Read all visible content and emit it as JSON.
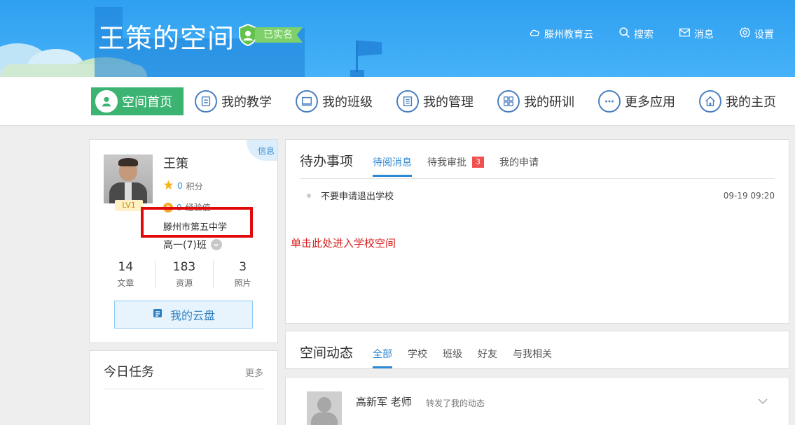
{
  "header": {
    "site_title": "王策的空间",
    "verify_label": "已实名",
    "links": [
      {
        "label": "滕州教育云",
        "icon": "cloud-icon"
      },
      {
        "label": "搜索",
        "icon": "search-icon"
      },
      {
        "label": "消息",
        "icon": "mail-icon"
      },
      {
        "label": "设置",
        "icon": "gear-icon"
      }
    ]
  },
  "mainnav": {
    "items": [
      {
        "label": "空间首页",
        "icon": "user-icon",
        "active": true
      },
      {
        "label": "我的教学",
        "icon": "document-icon"
      },
      {
        "label": "我的班级",
        "icon": "monitor-icon"
      },
      {
        "label": "我的管理",
        "icon": "list-icon"
      },
      {
        "label": "我的研训",
        "icon": "grid-icon"
      },
      {
        "label": "更多应用",
        "icon": "more-icon"
      },
      {
        "label": "我的主页",
        "icon": "home-icon"
      }
    ]
  },
  "profile": {
    "name": "王策",
    "level": "LV1",
    "info_label": "信息",
    "points_value": "0",
    "points_label": "积分",
    "exp_value": "0",
    "exp_label": "经验值",
    "school": "滕州市第五中学",
    "class_name": "高一(7)班",
    "stats": [
      {
        "value": "14",
        "label": "文章"
      },
      {
        "value": "183",
        "label": "资源"
      },
      {
        "value": "3",
        "label": "照片"
      }
    ],
    "cloud_button": "我的云盘"
  },
  "tasks": {
    "title": "今日任务",
    "more": "更多"
  },
  "todo": {
    "title": "待办事项",
    "tabs": [
      {
        "label": "待阅消息",
        "active": true
      },
      {
        "label": "待我审批",
        "badge": "3"
      },
      {
        "label": "我的申请"
      }
    ],
    "messages": [
      {
        "text": "不要申请退出学校",
        "time": "09-19 09:20"
      }
    ]
  },
  "annotation": "单击此处进入学校空间",
  "feed": {
    "title": "空间动态",
    "tabs": [
      {
        "label": "全部",
        "active": true
      },
      {
        "label": "学校"
      },
      {
        "label": "班级"
      },
      {
        "label": "好友"
      },
      {
        "label": "与我相关"
      }
    ],
    "post": {
      "author": "高新军 老师",
      "action": "转发了我的动态"
    }
  },
  "colors": {
    "header_blue": "#2f9ff0",
    "active_green": "#3cb371",
    "link_blue": "#2f8ad6",
    "highlight_red": "#e10a0a"
  }
}
